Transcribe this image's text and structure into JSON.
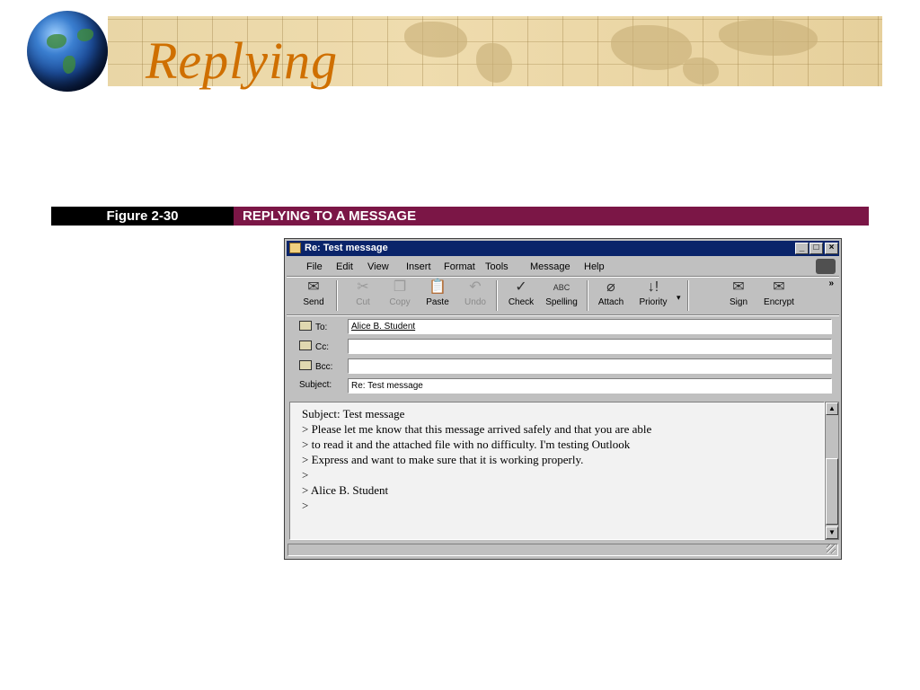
{
  "slide": {
    "title": "Replying"
  },
  "figure": {
    "number": "Figure 2-30",
    "caption": "REPLYING TO A MESSAGE"
  },
  "window": {
    "title": "Re: Test message",
    "controls": {
      "minimize": "_",
      "maximize": "□",
      "close": "×"
    },
    "menu": [
      "File",
      "Edit",
      "View",
      "Insert",
      "Format",
      "Tools",
      "Message",
      "Help"
    ],
    "toolbar": {
      "send": "Send",
      "cut": "Cut",
      "copy": "Copy",
      "paste": "Paste",
      "undo": "Undo",
      "check": "Check",
      "spelling": "Spelling",
      "attach": "Attach",
      "priority": "Priority",
      "sign": "Sign",
      "encrypt": "Encrypt",
      "more": "»"
    },
    "headers": {
      "to_label": "To:",
      "to_value": "Alice B. Student",
      "cc_label": "Cc:",
      "cc_value": "",
      "bcc_label": "Bcc:",
      "bcc_value": "",
      "subject_label": "Subject:",
      "subject_value": "Re: Test message"
    },
    "body_lines": [
      "Subject: Test message",
      "",
      "> Please let me know that this message arrived safely and that you are able",
      "> to read it and the attached file with no difficulty. I'm testing Outlook",
      "> Express and want to make sure that it is working properly.",
      ">",
      "> Alice B. Student",
      ">"
    ]
  }
}
